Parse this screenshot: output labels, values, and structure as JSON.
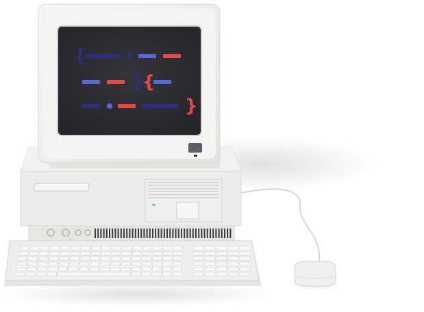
{
  "illustration": {
    "subject_icon": "retro-desktop-computer-icon",
    "colors": {
      "background": "#ffffff",
      "casing": "#eeeeec",
      "casing_shadow": "#d7d7d4",
      "bezel": "#f2f2f0",
      "screen": "#2f2f36",
      "screen_dark": "#26262c",
      "accent_navy": "#2d2f7a",
      "accent_blue": "#5568d6",
      "accent_red": "#e24a4a",
      "cable": "#d8d8d6",
      "led": "#7ed38a"
    },
    "screen_code": {
      "lines": [
        {
          "tokens": [
            {
              "type": "brace-open",
              "color": "accent_navy"
            },
            {
              "type": "dash",
              "color": "accent_navy",
              "length": 2
            },
            {
              "type": "dot",
              "color": "accent_navy"
            },
            {
              "type": "dash",
              "color": "accent_blue",
              "length": 1
            },
            {
              "type": "dash",
              "color": "accent_red",
              "length": 1
            }
          ]
        },
        {
          "tokens": [
            {
              "type": "dash",
              "color": "accent_blue",
              "length": 1
            },
            {
              "type": "dash",
              "color": "accent_red",
              "length": 1
            },
            {
              "type": "brace-close",
              "color": "accent_navy"
            },
            {
              "type": "brace-open",
              "color": "accent_red"
            },
            {
              "type": "dash",
              "color": "accent_blue",
              "length": 1
            }
          ]
        },
        {
          "tokens": [
            {
              "type": "dash",
              "color": "accent_navy",
              "length": 1
            },
            {
              "type": "dot",
              "color": "accent_blue"
            },
            {
              "type": "dash",
              "color": "accent_red",
              "length": 1
            },
            {
              "type": "dash",
              "color": "accent_navy",
              "length": 2
            },
            {
              "type": "brace-close",
              "color": "accent_red"
            }
          ]
        }
      ]
    },
    "keyboard": {
      "rows": 6
    }
  }
}
